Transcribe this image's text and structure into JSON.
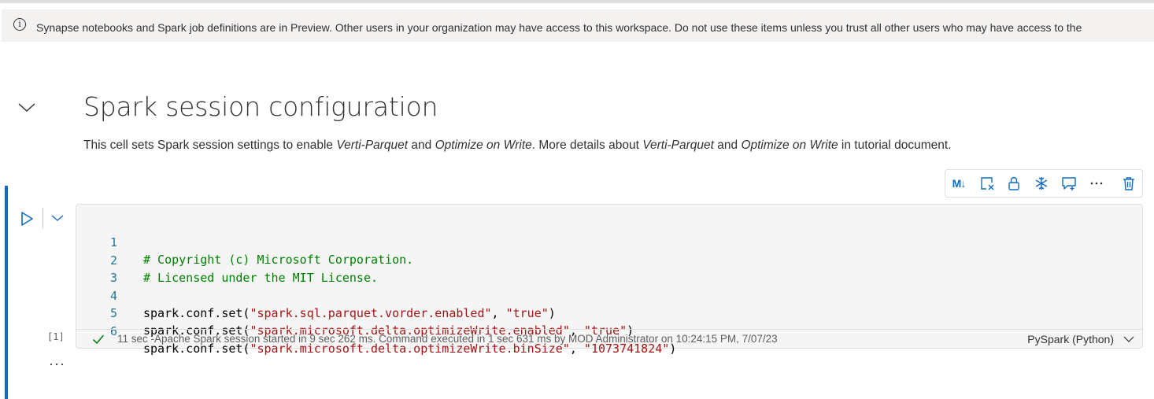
{
  "banner": {
    "text": "Synapse notebooks and Spark job definitions are in Preview. Other users in your organization may have access to this workspace. Do not use these items unless you trust all other users who may have access to the workspace.",
    "icon": "info-icon"
  },
  "markdown_cell": {
    "title": "Spark session configuration",
    "desc_part1": "This cell sets Spark session settings to enable ",
    "desc_em1": "Verti-Parquet",
    "desc_part2": " and ",
    "desc_em2": "Optimize on Write",
    "desc_part3": ". More details about ",
    "desc_em3": "Verti-Parquet",
    "desc_part4": " and ",
    "desc_em4": "Optimize on Write",
    "desc_part5": " in tutorial document."
  },
  "toolbar": {
    "markdown_label": "M↓",
    "icons": [
      "markdown-toggle-icon",
      "clear-output-icon",
      "lock-icon",
      "freeze-icon",
      "comment-icon",
      "more-icon",
      "delete-icon"
    ]
  },
  "code_cell": {
    "execution_count": "[1]",
    "lines": [
      {
        "num": "1",
        "comment": "# Copyright (c) Microsoft Corporation."
      },
      {
        "num": "2",
        "comment": "# Licensed under the MIT License."
      },
      {
        "num": "3"
      },
      {
        "num": "4",
        "pre": "spark.conf.set(",
        "s1": "\"spark.sql.parquet.vorder.enabled\"",
        "mid": ", ",
        "s2": "\"true\"",
        "post": ")"
      },
      {
        "num": "5",
        "pre": "spark.conf.set(",
        "s1": "\"spark.microsoft.delta.optimizeWrite.enabled\"",
        "mid": ", ",
        "s2": "\"true\"",
        "post": ")"
      },
      {
        "num": "6",
        "pre": "spark.conf.set(",
        "s1": "\"spark.microsoft.delta.optimizeWrite.binSize\"",
        "mid": ", ",
        "s2": "\"1073741824\"",
        "post": ")"
      }
    ],
    "status": "11 sec -Apache Spark session started in 9 sec 262 ms. Command executed in 1 sec 631 ms by MOD Administrator on 10:24:15 PM, 7/07/23",
    "language": "PySpark (Python)"
  },
  "more_below": "···",
  "colors": {
    "accent": "#0f6cbd",
    "success": "#107c10",
    "comment": "#008000",
    "string": "#a31515"
  }
}
